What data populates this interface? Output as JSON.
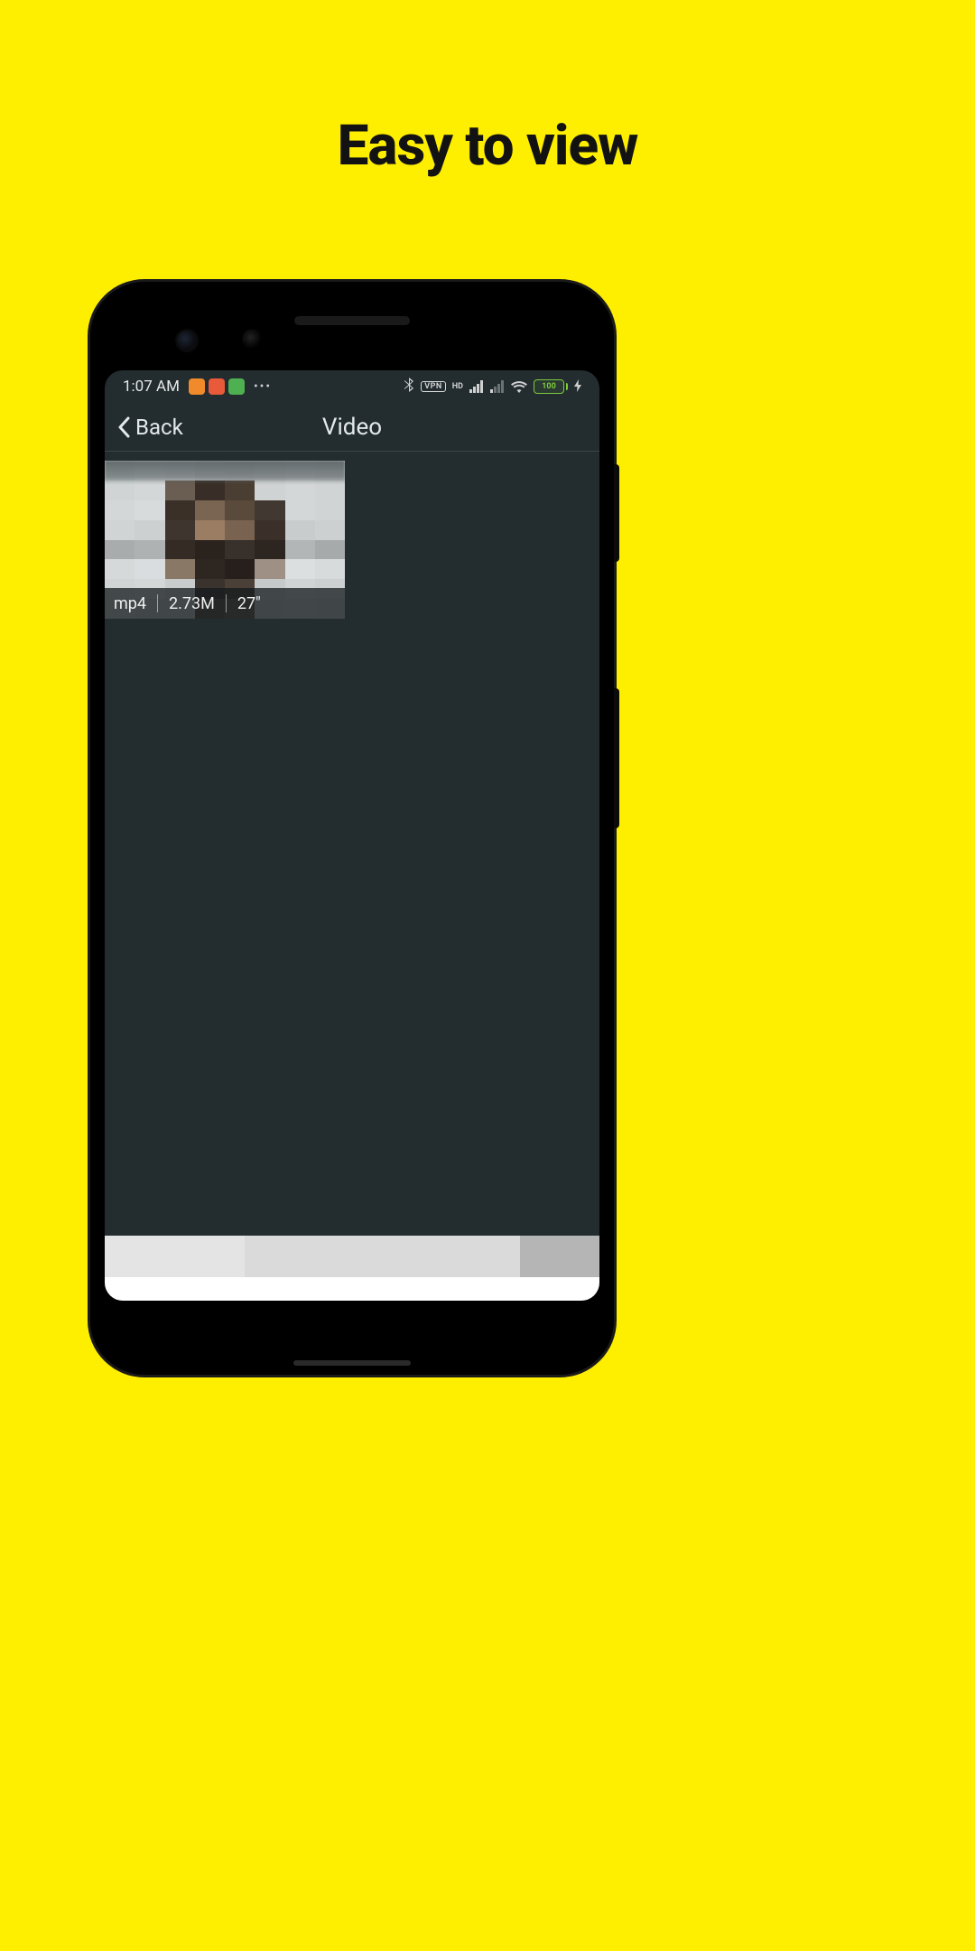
{
  "heading": "Easy to view",
  "status_bar": {
    "time": "1:07 AM",
    "vpn_label": "VPN",
    "hd_label": "HD",
    "battery_percent": "100"
  },
  "nav": {
    "back_label": "Back",
    "title": "Video"
  },
  "video": {
    "format": "mp4",
    "size": "2.73M",
    "duration": "27\""
  }
}
